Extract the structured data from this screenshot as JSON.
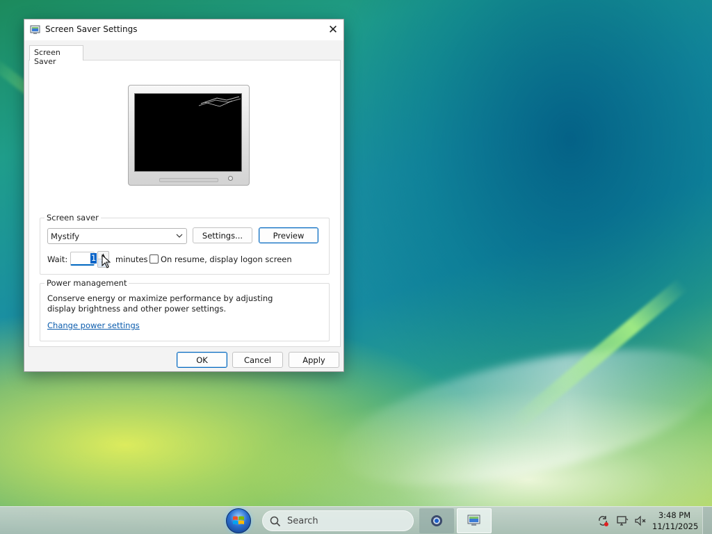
{
  "window": {
    "title": "Screen Saver Settings",
    "close_glyph": "✕",
    "tab_label": "Screen Saver"
  },
  "screen_saver": {
    "group_label": "Screen saver",
    "selected": "Mystify",
    "settings_label": "Settings...",
    "preview_label": "Preview",
    "wait_label": "Wait:",
    "wait_value": "1",
    "minutes_label": "minutes",
    "logon_checkbox_label": "On resume, display logon screen",
    "logon_checked": false
  },
  "power": {
    "group_label": "Power management",
    "description": "Conserve energy or maximize performance by adjusting display brightness and other power settings.",
    "link": "Change power settings"
  },
  "buttons": {
    "ok": "OK",
    "cancel": "Cancel",
    "apply": "Apply"
  },
  "taskbar": {
    "search_placeholder": "Search",
    "time": "3:48 PM",
    "date": "11/11/2025"
  },
  "colors": {
    "accent": "#0067c0",
    "link": "#0b5cad"
  }
}
